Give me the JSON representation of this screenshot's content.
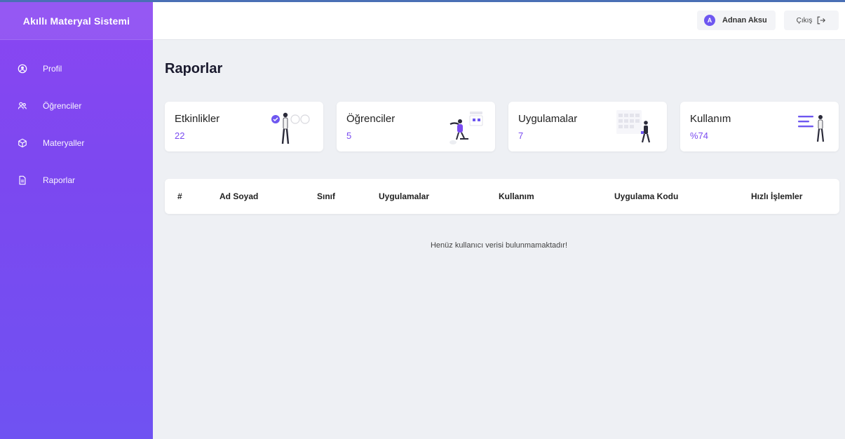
{
  "app": {
    "title": "Akıllı Materyal Sistemi"
  },
  "sidebar": {
    "items": [
      {
        "label": "Profil",
        "icon": "user-circle-icon"
      },
      {
        "label": "Öğrenciler",
        "icon": "users-icon"
      },
      {
        "label": "Materyaller",
        "icon": "cube-icon"
      },
      {
        "label": "Raporlar",
        "icon": "document-icon"
      }
    ]
  },
  "header": {
    "user": {
      "initial": "A",
      "name": "Adnan Aksu"
    },
    "logout_label": "Çıkış"
  },
  "main": {
    "title": "Raporlar",
    "cards": [
      {
        "title": "Etkinlikler",
        "value": "22"
      },
      {
        "title": "Öğrenciler",
        "value": "5"
      },
      {
        "title": "Uygulamalar",
        "value": "7"
      },
      {
        "title": "Kullanım",
        "value": "%74"
      }
    ],
    "table": {
      "columns": [
        "#",
        "Ad Soyad",
        "Sınıf",
        "Uygulamalar",
        "Kullanım",
        "Uygulama Kodu",
        "Hızlı İşlemler"
      ]
    },
    "empty_message": "Henüz kullanıcı verisi bulunmamaktadır!"
  },
  "colors": {
    "sidebar": "#7c48f0",
    "accent": "#7a4bf0",
    "avatar": "#6e57f0"
  }
}
